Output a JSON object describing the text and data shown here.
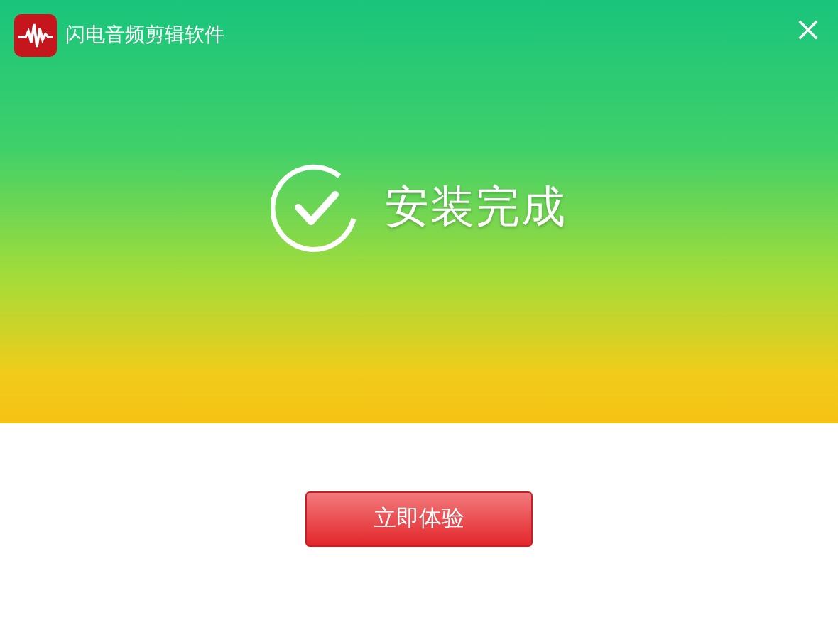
{
  "window": {
    "title": "闪电音频剪辑软件"
  },
  "status": {
    "message": "安装完成"
  },
  "buttons": [
    {
      "label": "立即体验"
    }
  ]
}
